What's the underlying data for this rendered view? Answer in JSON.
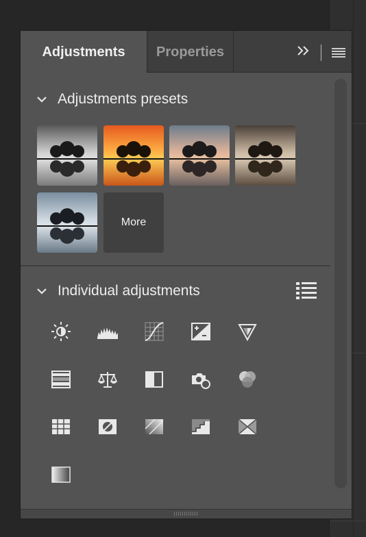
{
  "tabs": [
    {
      "label": "Adjustments",
      "active": true
    },
    {
      "label": "Properties",
      "active": false
    }
  ],
  "presets_section": {
    "title": "Adjustments presets",
    "presets": [
      {
        "name": "black-and-white"
      },
      {
        "name": "sunset-orange"
      },
      {
        "name": "warm-pastel"
      },
      {
        "name": "sepia"
      },
      {
        "name": "cool-blue"
      }
    ],
    "more_label": "More"
  },
  "individual_section": {
    "title": "Individual adjustments",
    "icons": [
      "brightness-contrast-icon",
      "levels-icon",
      "curves-icon",
      "exposure-icon",
      "vibrance-icon",
      "hue-saturation-icon",
      "color-balance-icon",
      "black-white-icon",
      "photo-filter-icon",
      "channel-mixer-icon",
      "color-lookup-icon",
      "invert-icon",
      "posterize-icon",
      "threshold-icon",
      "selective-color-icon",
      "gradient-map-icon"
    ]
  },
  "colors": {
    "panel": "#535353",
    "tab_bar": "#3e3e3e",
    "icon": "#e8e8e8"
  }
}
